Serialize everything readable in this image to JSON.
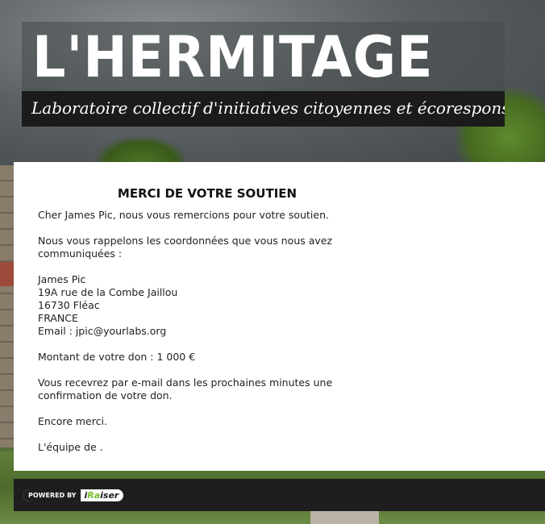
{
  "header": {
    "title": "L'HERMITAGE",
    "tagline": "Laboratoire collectif d'initiatives citoyennes et écoresponsables"
  },
  "confirmation": {
    "heading": "MERCI DE VOTRE SOUTIEN",
    "greeting": "Cher James Pic, nous vous remercions pour votre soutien.",
    "intro": "Nous vous rappelons les coordonnées que vous nous avez communiquées :",
    "address": {
      "name": "James Pic",
      "street": "19A rue de la Combe Jaillou",
      "city": "16730 Fléac",
      "country": "FRANCE",
      "email": "Email : jpic@yourlabs.org"
    },
    "amount": "Montant de votre don : 1 000 €",
    "email_notice": "Vous recevrez par e-mail dans les prochaines minutes une confirmation de votre don.",
    "thanks": "Encore merci.",
    "signature": "L'équipe de ."
  },
  "footer": {
    "powered_by": "POWERED BY",
    "brand_prefix": "i",
    "brand_accent": "Ra",
    "brand_suffix": "iser"
  },
  "colors": {
    "brand_accent": "#77c12b",
    "footer_bg": "#1e1e1e"
  }
}
